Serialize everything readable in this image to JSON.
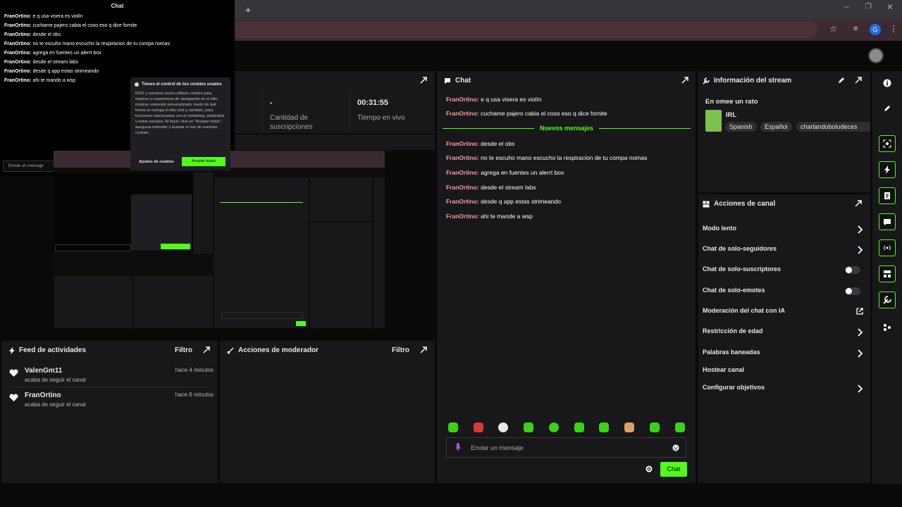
{
  "popout": {
    "title": "Chat",
    "messages": [
      {
        "user": "FranOrtino:",
        "text": " e q usa visera es violín"
      },
      {
        "user": "FranOrtino:",
        "text": " cuchame pajero cabia el coso eso q dice fornite"
      },
      {
        "user": "FranOrtino:",
        "text": " desde el obs"
      },
      {
        "user": "FranOrtino:",
        "text": " no te escuho mano escucho la respiracion de tu compa nomas"
      },
      {
        "user": "FranOrtino:",
        "text": " agrega en fuentes un alerrt box"
      },
      {
        "user": "FranOrtino:",
        "text": " desde el stream labs"
      },
      {
        "user": "FranOrtino:",
        "text": " desde q app estas strimeando"
      },
      {
        "user": "FranOrtino:",
        "text": " ahi te mando a wsp"
      }
    ],
    "input_placeholder": "Enviar un mensaje"
  },
  "cookie": {
    "title": "Tienes el control de tus cookies usados",
    "body": "KICK y nuestros socios utilizan cookies para mejorar tu experiencia de navegación en el sitio, mostrar contenido personalizado, medir de qué forma se navega el sitio web y, también, para funciones relacionadas con el marketing, publicidad y redes sociales. Al hacer click en \"Aceptar todas\", aseguras entender y aceptar el uso de nuestras cookies.",
    "settings_label": "Ajustes de cookies",
    "accept_label": "Aceptar todas"
  },
  "stats": {
    "subs_value": "-",
    "subs_label": "Cantidad de suscripciones",
    "time_value": "00:31:55",
    "time_label": "Tiempo en vivo"
  },
  "feed": {
    "title": "Feed de actividades",
    "filter": "Filtro",
    "items": [
      {
        "user": "ValenGm11",
        "sub": "acaba de seguir el canal",
        "time": "hace 4 minutos"
      },
      {
        "user": "FranOrtino",
        "sub": "acaba de seguir el canal",
        "time": "hace 6 minutos"
      }
    ]
  },
  "mod": {
    "title": "Acciones de moderador",
    "filter": "Filtro"
  },
  "chat": {
    "title": "Chat",
    "before": [
      {
        "user": "FranOrtino:",
        "text": " e q usa visera es violín"
      },
      {
        "user": "FranOrtino:",
        "text": " cuchame pajero cabia el coso eso q dice fornite"
      }
    ],
    "new_messages": "Nuevos mensajes",
    "after": [
      {
        "user": "FranOrtino:",
        "text": " desde el obs"
      },
      {
        "user": "FranOrtino:",
        "text": " no te escuho mano escucho la respiracion de tu compa nomas"
      },
      {
        "user": "FranOrtino:",
        "text": " agrega en fuentes un alerrt box"
      },
      {
        "user": "FranOrtino:",
        "text": " desde el stream labs"
      },
      {
        "user": "FranOrtino:",
        "text": " desde q app estas strimeando"
      },
      {
        "user": "FranOrtino:",
        "text": " ahi te mande a wsp"
      }
    ],
    "input_placeholder": "Enviar un mensaje",
    "send_label": "Chat"
  },
  "info": {
    "title": "Información del stream",
    "stream_title": "En omee un rato",
    "category": "IRL",
    "tags": [
      "Spanish",
      "Español",
      "charlandoboludeces"
    ]
  },
  "actions": {
    "title": "Acciones de canal",
    "rows": [
      {
        "label": "Modo lento",
        "control": "chevron"
      },
      {
        "label": "Chat de solo-seguidores",
        "control": "chevron"
      },
      {
        "label": "Chat de solo-suscriptores",
        "control": "toggle"
      },
      {
        "label": "Chat de solo-emotes",
        "control": "toggle"
      },
      {
        "label": "Moderación del chat con IA",
        "control": "external"
      },
      {
        "label": "Restricción de edad",
        "control": "chevron"
      },
      {
        "label": "Palabras baneadas",
        "control": "chevron"
      },
      {
        "label": "Hostear canal",
        "control": "none"
      },
      {
        "label": "Configurar objetivos",
        "control": "chevron"
      }
    ]
  },
  "browser": {
    "profile_initial": "G"
  },
  "colors": {
    "accent": "#53fc18",
    "username": "#ff9aa0",
    "panel": "#18181b"
  }
}
